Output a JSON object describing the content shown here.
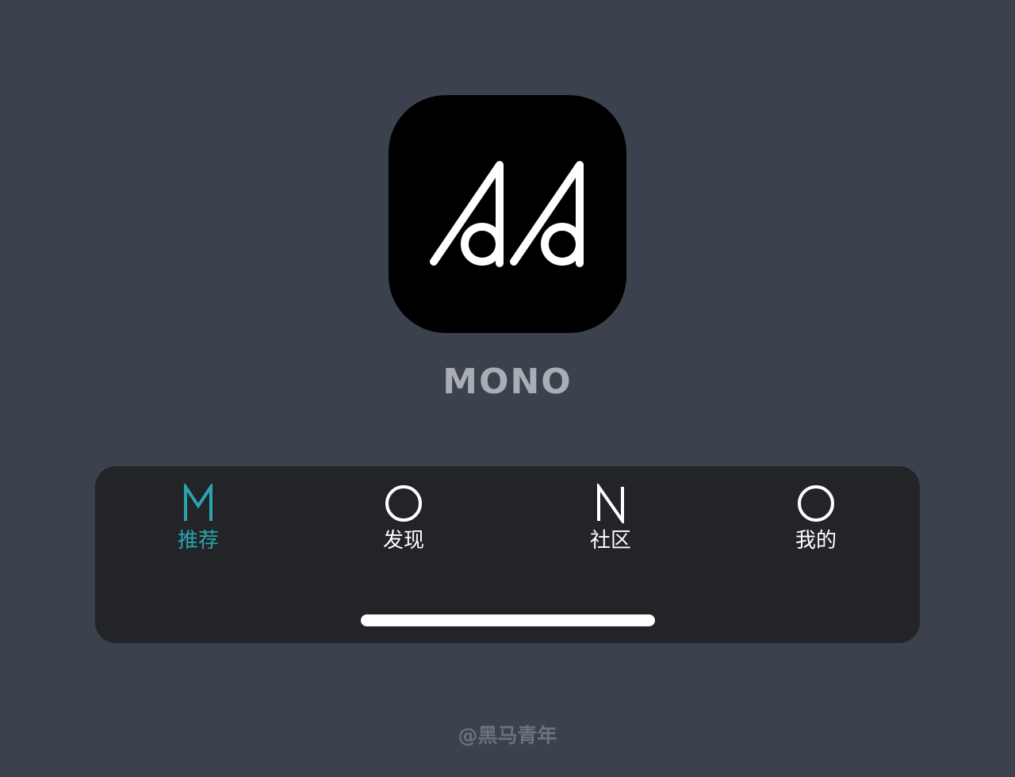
{
  "app": {
    "name": "MONO",
    "icon": "mono-logo-icon"
  },
  "tabbar": {
    "active_color": "#2aa3ad",
    "inactive_color": "#ffffff",
    "tabs": [
      {
        "label": "推荐",
        "icon": "letter-m-icon",
        "active": true
      },
      {
        "label": "发现",
        "icon": "letter-o-icon",
        "active": false
      },
      {
        "label": "社区",
        "icon": "letter-n-icon",
        "active": false
      },
      {
        "label": "我的",
        "icon": "letter-o-icon",
        "active": false
      }
    ]
  },
  "watermark": "@黑马青年",
  "colors": {
    "background": "#3b424e",
    "tabbar_background": "#222428",
    "icon_background": "#000000"
  }
}
